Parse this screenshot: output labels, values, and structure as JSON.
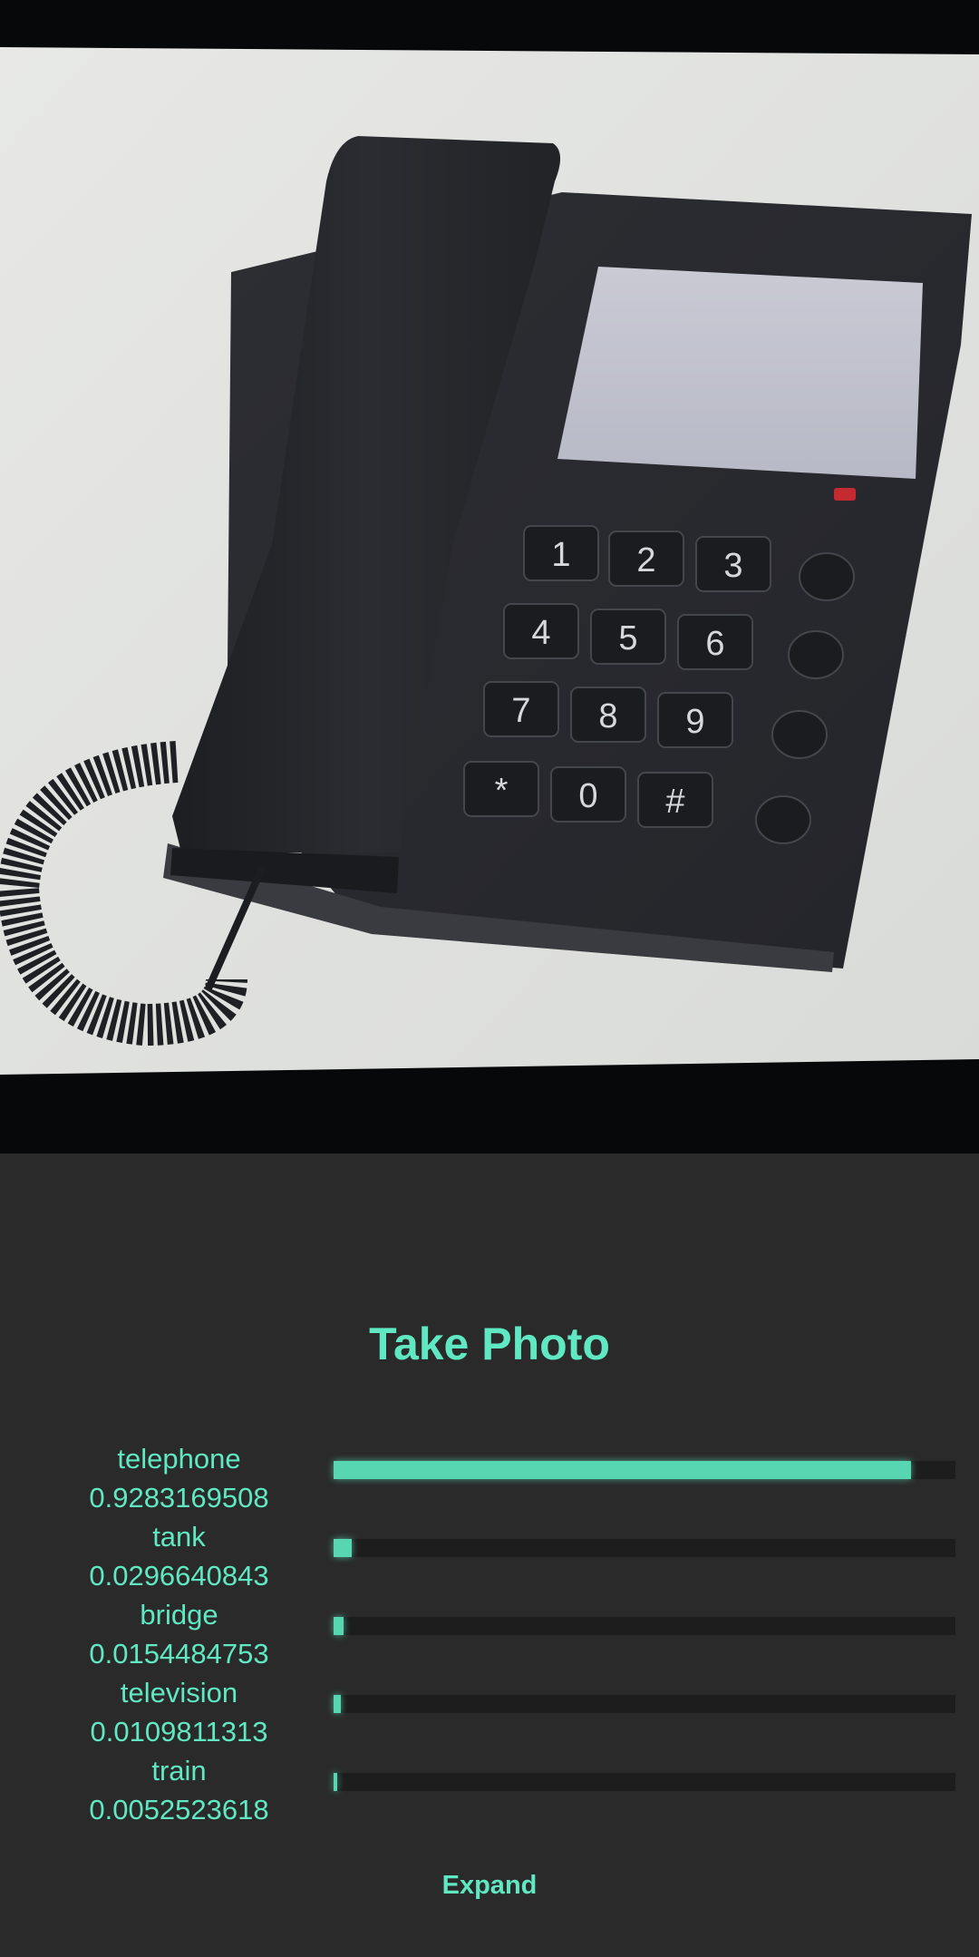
{
  "camera": {
    "subject": "telephone",
    "keypad_keys": [
      "1",
      "2",
      "3",
      "4",
      "5",
      "6",
      "7",
      "8",
      "9",
      "*",
      "0",
      "#"
    ]
  },
  "actions": {
    "take_photo_label": "Take Photo",
    "expand_label": "Expand"
  },
  "results": [
    {
      "label": "telephone",
      "score": "0.9283169508",
      "confidence": 0.9283169508
    },
    {
      "label": "tank",
      "score": "0.0296640843",
      "confidence": 0.0296640843
    },
    {
      "label": "bridge",
      "score": "0.0154484753",
      "confidence": 0.0154484753
    },
    {
      "label": "television",
      "score": "0.0109811313",
      "confidence": 0.0109811313
    },
    {
      "label": "train",
      "score": "0.0052523618",
      "confidence": 0.0052523618
    }
  ],
  "colors": {
    "accent": "#5fe8c2",
    "bar_fill": "#58d5b1",
    "bar_track": "#1d1d1d",
    "panel_background": "#2a2a2a"
  }
}
